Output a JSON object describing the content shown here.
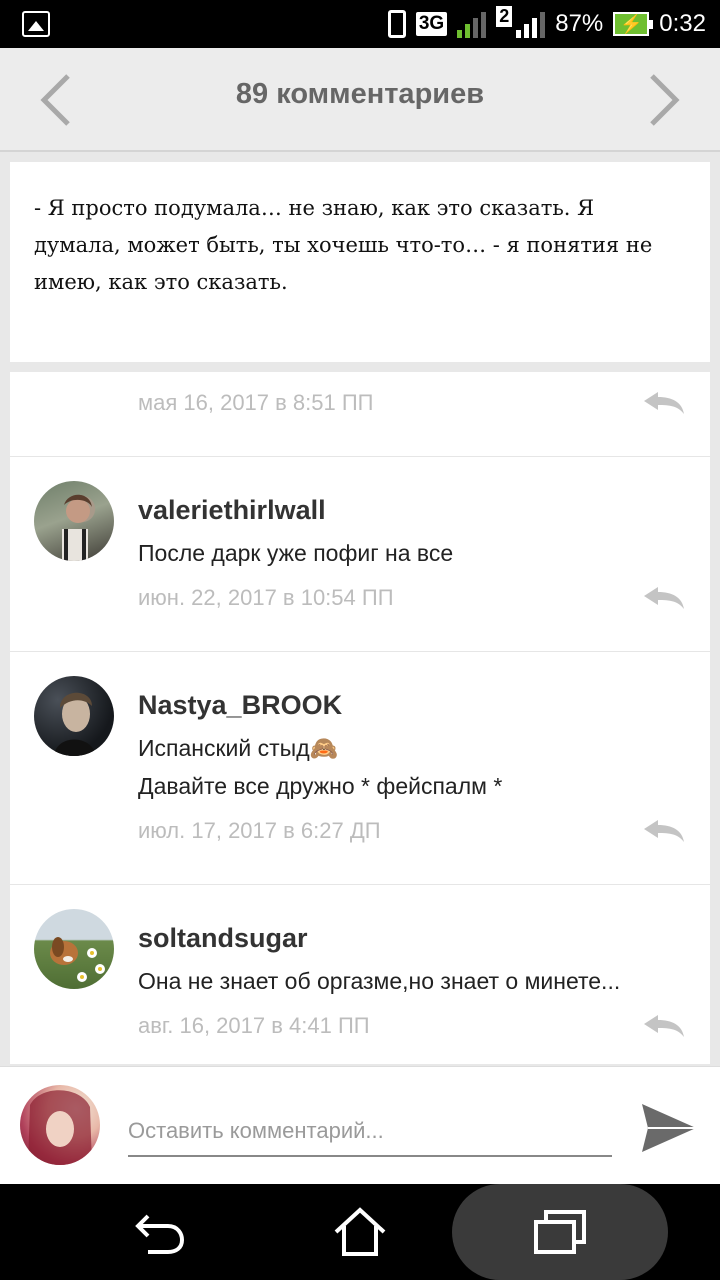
{
  "status_bar": {
    "network": "3G",
    "sim_slot": "2",
    "battery": "87%",
    "time": "0:32"
  },
  "header": {
    "title": "89 комментариев"
  },
  "excerpt": {
    "text": "- Я просто подумала… не знаю, как это сказать. Я думала, может быть, ты хочешь что-то… - я понятия не имею, как это сказать."
  },
  "comments": [
    {
      "author": "",
      "lines": [],
      "date": "мая 16, 2017 в 8:51 ПП"
    },
    {
      "author": "valeriethirlwall",
      "lines": [
        "После дарк уже пофиг на все"
      ],
      "date": "июн. 22, 2017 в 10:54 ПП"
    },
    {
      "author": "Nastya_BROOK",
      "lines": [
        "Испанский стыд🙈",
        "Давайте все дружно * фейспалм *"
      ],
      "date": "июл. 17, 2017 в 6:27 ДП"
    },
    {
      "author": "soltandsugar",
      "lines": [
        "Она не знает об оргазме,но знает о минете..."
      ],
      "date": "авг. 16, 2017 в 4:41 ПП"
    }
  ],
  "composer": {
    "placeholder": "Оставить комментарий..."
  },
  "icons": {
    "prev": "chevron-left-icon",
    "next": "chevron-right-icon",
    "reply": "reply-icon",
    "send": "send-icon",
    "back": "back-icon",
    "home": "home-icon",
    "recent": "recent-apps-icon"
  },
  "colors": {
    "header_bg": "#ececec",
    "title": "#666666",
    "date": "#bcbcbc",
    "reply_icon": "#c4c4c4"
  }
}
